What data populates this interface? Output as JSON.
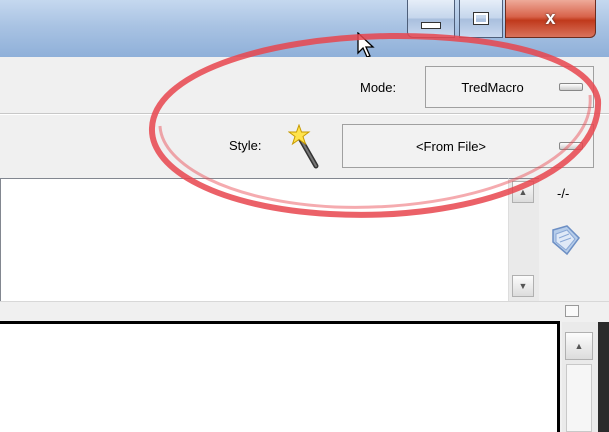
{
  "window": {
    "minimize_icon": "minimize-icon",
    "maximize_icon": "maximize-icon",
    "close_glyph": "x"
  },
  "mode": {
    "label": "Mode:",
    "value": "TredMacro"
  },
  "style": {
    "label": "Style:",
    "icon": "magic-wand-icon",
    "value": "<From File>"
  },
  "side_toolbar": {
    "zoom_label": "-/-",
    "bookmark_icon": "book-icon"
  },
  "scrollbars": {
    "up_arrow": "▲",
    "down_arrow": "▼"
  },
  "annotation": {
    "color": "#e8454d",
    "shape": "ellipse"
  },
  "colors": {
    "titlebar": "#a9c3e3",
    "close_button": "#c0391b",
    "background": "#f0f0f0"
  }
}
